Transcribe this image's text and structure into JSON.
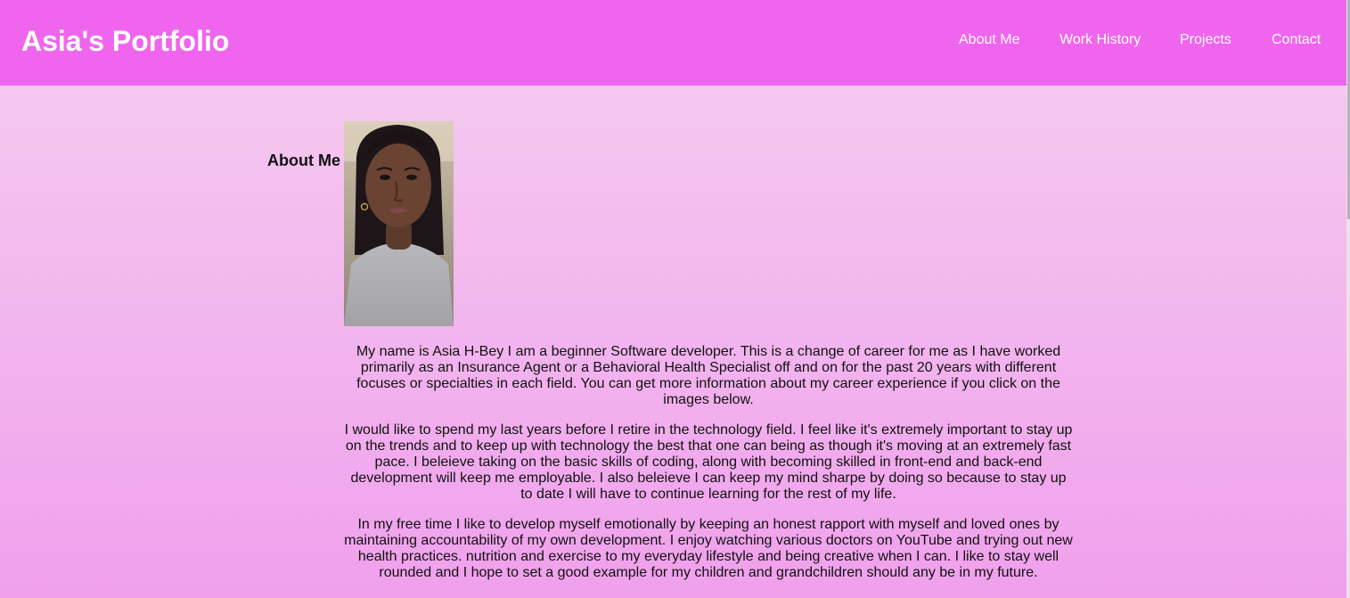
{
  "header": {
    "brand": "Asia's Portfolio",
    "nav": [
      {
        "label": "About Me"
      },
      {
        "label": "Work History"
      },
      {
        "label": "Projects"
      },
      {
        "label": "Contact"
      }
    ]
  },
  "about": {
    "heading": "About Me",
    "photo_icon": "portrait-photo",
    "paragraphs": [
      "My name is Asia H-Bey I am a beginner Software developer. This is a change of career for me as I have worked primarily as an Insurance Agent or a Behavioral Health Specialist off and on for the past 20 years with different focuses or specialties in each field. You can get more information about my career experience if you click on the images below.",
      "I would like to spend my last years before I retire in the technology field. I feel like it's extremely important to stay up on the trends and to keep up with technology the best that one can being as though it's moving at an extremely fast pace. I beleieve taking on the basic skills of coding, along with becoming skilled in front-end and back-end development will keep me employable. I also beleieve I can keep my mind sharpe by doing so because to stay up to date I will have to continue learning for the rest of my life.",
      "In my free time I like to develop myself emotionally by keeping an honest rapport with myself and loved ones by maintaining accountability of my own development. I enjoy watching various doctors on YouTube and trying out new health practices. nutrition and exercise to my everyday lifestyle and being creative when I can. I like to stay well rounded and I hope to set a good example for my children and grandchildren should any be in my future.",
      ""
    ]
  },
  "colors": {
    "header_bg": "#f065ee",
    "page_bg_top": "#f5cff0",
    "page_bg_bottom": "#f0a0ec",
    "header_text": "#ffffff"
  }
}
